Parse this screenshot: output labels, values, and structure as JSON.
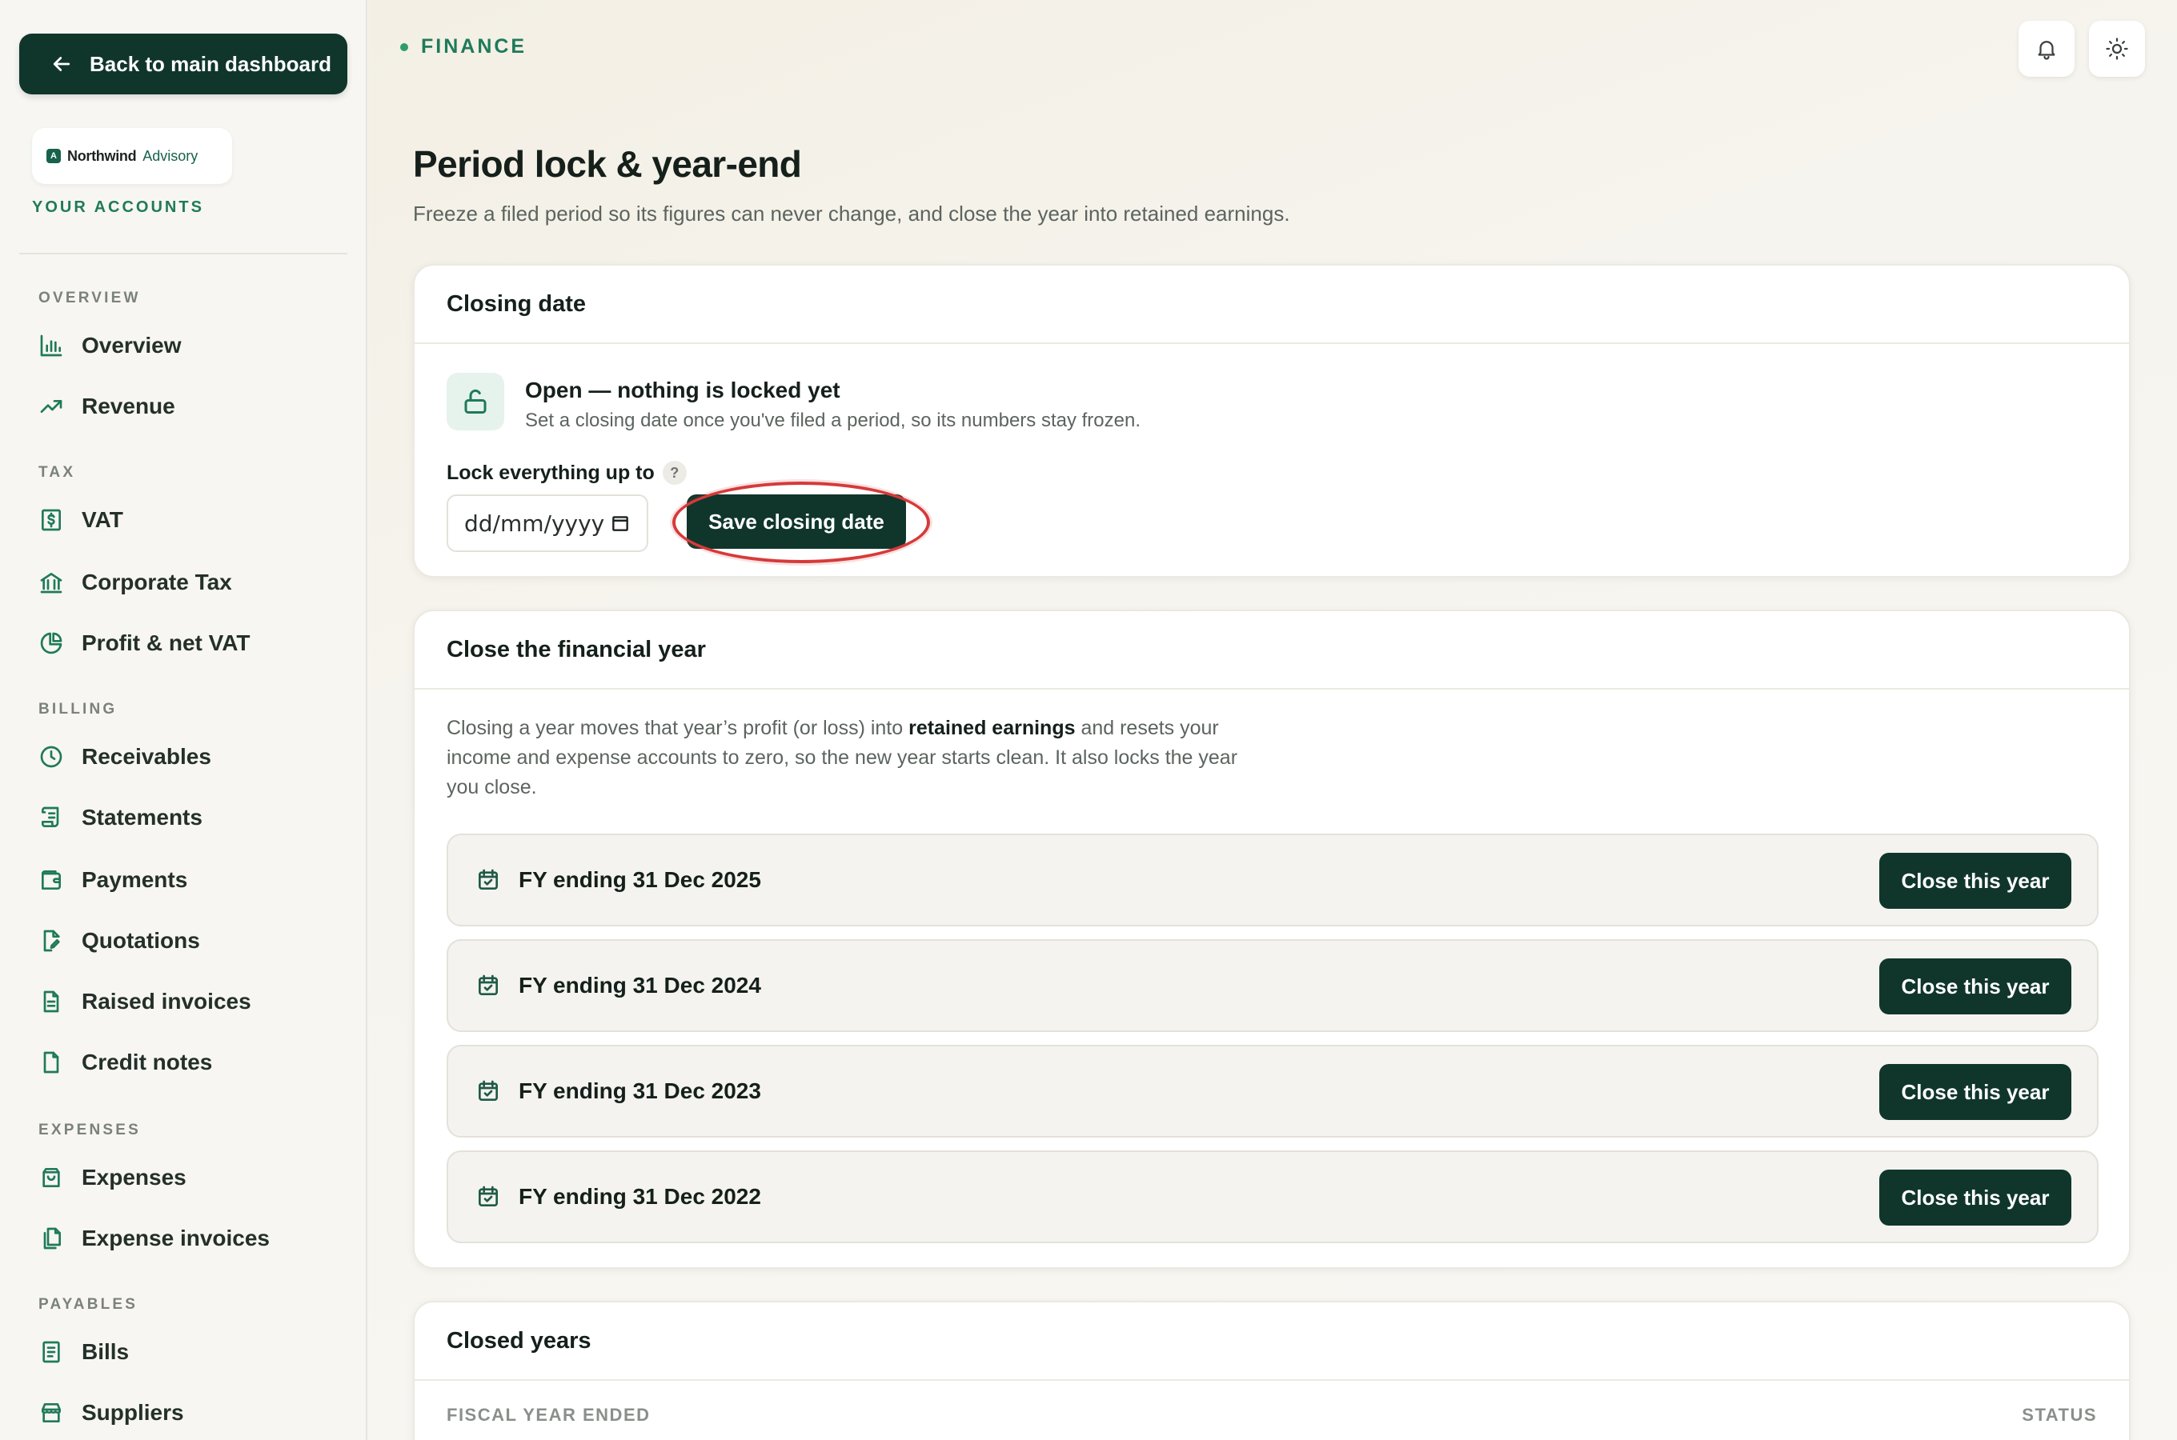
{
  "sidebar": {
    "back_label": "Back to main dashboard",
    "brand": {
      "name": "Northwind",
      "sub": "Advisory",
      "mark": "A"
    },
    "your_accounts": "YOUR ACCOUNTS",
    "sections": {
      "overview": "OVERVIEW",
      "tax": "TAX",
      "billing": "BILLING",
      "expenses": "EXPENSES",
      "payables": "PAYABLES"
    },
    "items": {
      "overview": "Overview",
      "revenue": "Revenue",
      "vat": "VAT",
      "corporate_tax": "Corporate Tax",
      "profit_net_vat": "Profit & net VAT",
      "receivables": "Receivables",
      "statements": "Statements",
      "payments": "Payments",
      "quotations": "Quotations",
      "raised_invoices": "Raised invoices",
      "credit_notes": "Credit notes",
      "expenses": "Expenses",
      "expense_invoices": "Expense invoices",
      "bills": "Bills",
      "suppliers": "Suppliers"
    }
  },
  "header": {
    "crumb": "FINANCE",
    "title": "Period lock & year-end",
    "subtitle": "Freeze a filed period so its figures can never change, and close the year into retained earnings."
  },
  "closing_date": {
    "title": "Closing date",
    "status_title": "Open — nothing is locked yet",
    "status_desc": "Set a closing date once you've filed a period, so its numbers stay frozen.",
    "lock_label": "Lock everything up to",
    "help": "?",
    "date_placeholder": "dd/mm/yyyy",
    "save_label": "Save closing date"
  },
  "close_year": {
    "title": "Close the financial year",
    "intro_pre": "Closing a year moves that year’s profit (or loss) into ",
    "intro_bold": "retained earnings",
    "intro_post": " and resets your income and expense accounts to zero, so the new year starts clean. It also locks the year you close.",
    "rows": [
      {
        "label": "FY ending 31 Dec 2025",
        "button": "Close this year"
      },
      {
        "label": "FY ending 31 Dec 2024",
        "button": "Close this year"
      },
      {
        "label": "FY ending 31 Dec 2023",
        "button": "Close this year"
      },
      {
        "label": "FY ending 31 Dec 2022",
        "button": "Close this year"
      }
    ]
  },
  "closed_years": {
    "title": "Closed years",
    "col_fiscal": "FISCAL YEAR ENDED",
    "col_status": "STATUS"
  },
  "colors": {
    "accent": "#10362b",
    "brand_green": "#1f7a5a",
    "highlight": "#d63a3a"
  },
  "icons": {
    "notifications": "bell-icon",
    "theme": "sun-icon"
  }
}
